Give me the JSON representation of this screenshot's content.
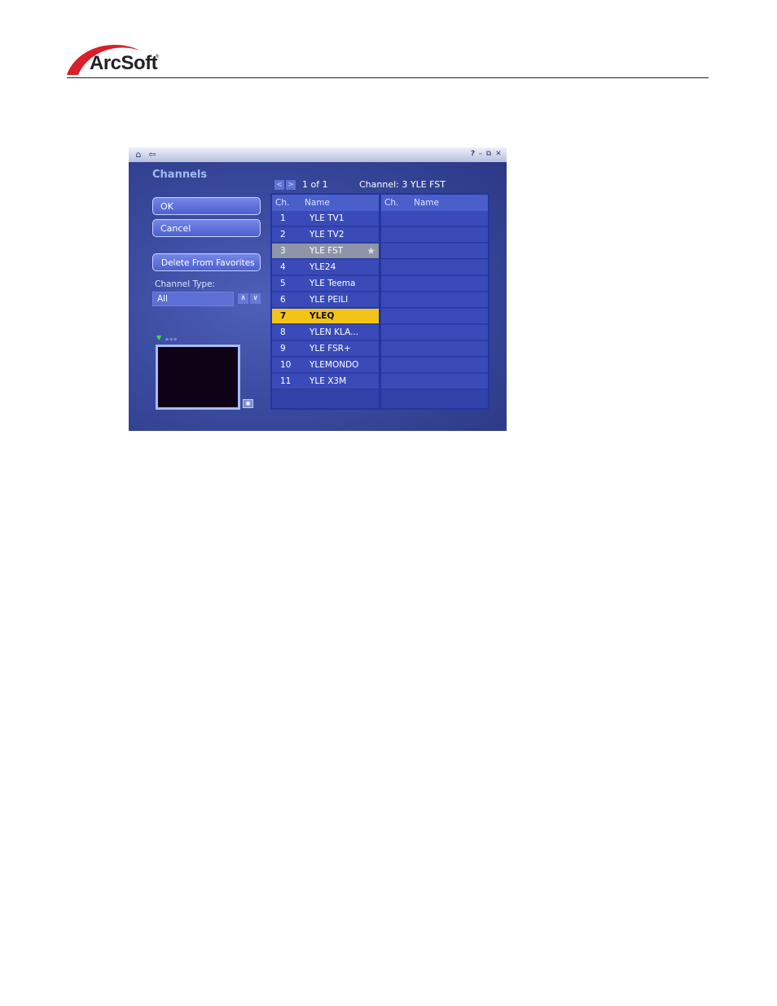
{
  "brand": {
    "name": "ArcSoft",
    "mark": "®"
  },
  "window": {
    "title": "Channels",
    "titlebar": {
      "home_icon": "home-icon",
      "back_icon": "back-arrow-icon",
      "controls": [
        "help-icon",
        "minimize-icon",
        "restore-icon",
        "close-icon"
      ]
    },
    "buttons": {
      "ok": "OK",
      "cancel": "Cancel",
      "delete_favorites": "Delete From Favorites"
    },
    "channel_type": {
      "label": "Channel Type:",
      "value": "All"
    },
    "paging": {
      "count": "1 of 1",
      "current_channel": "Channel: 3 YLE FST"
    },
    "list_headers": {
      "ch": "Ch.",
      "name": "Name"
    },
    "channels": [
      {
        "ch": "1",
        "name": "YLE TV1"
      },
      {
        "ch": "2",
        "name": "YLE TV2"
      },
      {
        "ch": "3",
        "name": "YLE FST"
      },
      {
        "ch": "4",
        "name": "YLE24"
      },
      {
        "ch": "5",
        "name": "YLE Teema"
      },
      {
        "ch": "6",
        "name": "YLE PEILI"
      },
      {
        "ch": "7",
        "name": "YLEQ"
      },
      {
        "ch": "8",
        "name": "YLEN KLA..."
      },
      {
        "ch": "9",
        "name": "YLE FSR+"
      },
      {
        "ch": "10",
        "name": "YLEMONDO"
      },
      {
        "ch": "11",
        "name": "YLE X3M"
      }
    ],
    "colors": {
      "accent": "#f2c41a",
      "selected_row": "#8f95a8",
      "panel": "#3a4bb9",
      "title": "#9fbcf4"
    }
  }
}
